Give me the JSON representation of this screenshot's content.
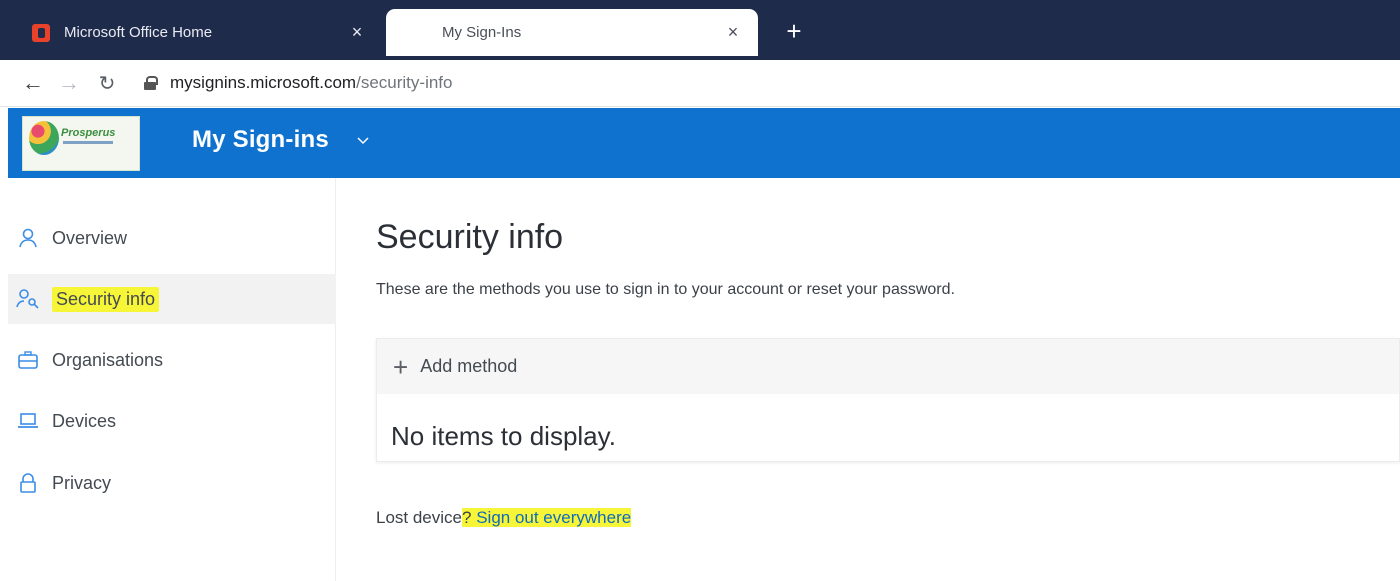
{
  "browser": {
    "tabs": [
      {
        "label": "Microsoft Office Home",
        "close": "×",
        "active": false
      },
      {
        "label": "My Sign-Ins",
        "close": "×",
        "active": true
      }
    ],
    "new_tab": "+",
    "url_host": "mysignins.microsoft.com",
    "url_path": "/security-info"
  },
  "header": {
    "logo_text": "Prosperus",
    "app_title": "My Sign-ins",
    "bg_color": "#0f72cf"
  },
  "sidebar": {
    "items": [
      {
        "label": "Overview",
        "icon": "person-icon"
      },
      {
        "label": "Security info",
        "icon": "security-key-person-icon",
        "selected": true
      },
      {
        "label": "Organisations",
        "icon": "briefcase-icon"
      },
      {
        "label": "Devices",
        "icon": "laptop-icon"
      },
      {
        "label": "Privacy",
        "icon": "lock-icon"
      }
    ]
  },
  "main": {
    "title": "Security info",
    "subtitle": "These are the methods you use to sign in to your account or reset your password.",
    "add_method": "Add method",
    "empty_text": "No items to display.",
    "lost_prefix": "Lost device",
    "lost_q": "?",
    "sign_out_link": "Sign out everywhere",
    "highlight_color": "#f7f538"
  }
}
